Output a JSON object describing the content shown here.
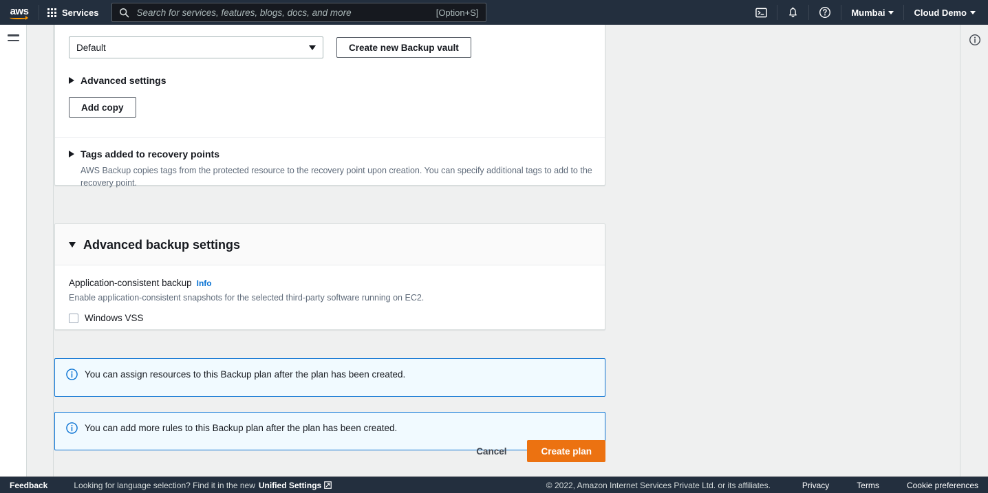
{
  "top_nav": {
    "logo": "aws",
    "services_label": "Services",
    "search": {
      "placeholder": "Search for services, features, blogs, docs, and more",
      "value": "",
      "shortcut": "[Option+S]",
      "icon": "search-icon"
    },
    "cloudshell_icon": "cloudshell-icon",
    "notifications_icon": "bell-icon",
    "help_icon": "question-circle-icon",
    "region_label": "Mumbai",
    "account_label": "Cloud Demo"
  },
  "rails": {
    "hamburger_icon": "hamburger-menu-icon",
    "info_panel_icon": "info-circle-icon"
  },
  "backup_vault": {
    "select_value": "Default",
    "select_caret_icon": "chevron-down-icon",
    "create_vault_button": "Create new Backup vault",
    "advanced_settings_label": "Advanced settings",
    "advanced_settings_icon": "triangle-right-icon",
    "add_copy_button": "Add copy"
  },
  "tags_section": {
    "title": "Tags added to recovery points",
    "expander_icon": "triangle-right-icon",
    "description": "AWS Backup copies tags from the protected resource to the recovery point upon creation. You can specify additional tags to add to the recovery point."
  },
  "advanced_backup": {
    "panel_title": "Advanced backup settings",
    "expander_icon": "triangle-down-icon",
    "field_label": "Application-consistent backup",
    "info_link": "Info",
    "field_description": "Enable application-consistent snapshots for the selected third-party software running on EC2.",
    "checkbox_label": "Windows VSS",
    "checkbox_checked": false
  },
  "alerts": [
    {
      "icon": "info-circle-icon",
      "text": "You can assign resources to this Backup plan after the plan has been created."
    },
    {
      "icon": "info-circle-icon",
      "text": "You can add more rules to this Backup plan after the plan has been created."
    }
  ],
  "actions": {
    "cancel_label": "Cancel",
    "create_label": "Create plan"
  },
  "footer": {
    "feedback": "Feedback",
    "language_text": "Looking for language selection? Find it in the new",
    "language_link": "Unified Settings",
    "external_link_icon": "external-link-icon",
    "copyright": "© 2022, Amazon Internet Services Private Ltd. or its affiliates.",
    "privacy": "Privacy",
    "terms": "Terms",
    "cookie_preferences": "Cookie preferences"
  },
  "colors": {
    "nav_background": "#232f3e",
    "page_background": "#eff0f0",
    "primary_button": "#ec7211",
    "link_blue": "#0972d3",
    "alert_background": "#f1faff"
  }
}
